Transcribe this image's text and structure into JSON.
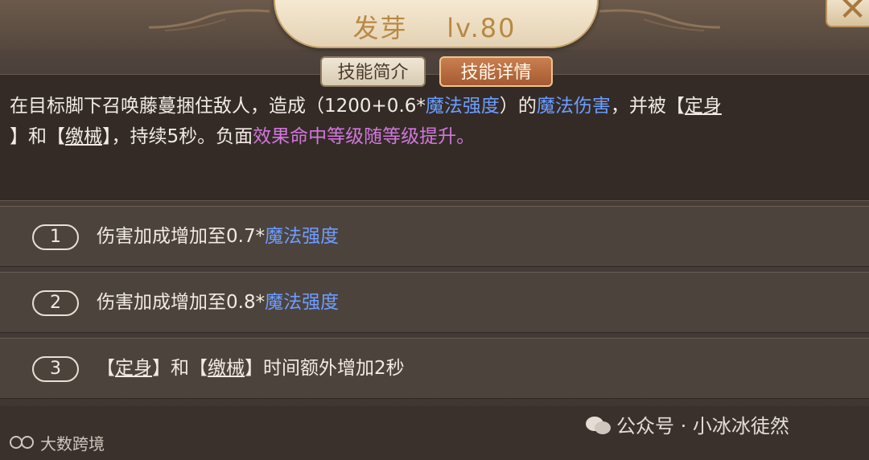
{
  "header": {
    "skill_name": "发芽",
    "level": "lv.80",
    "close_label": "✕"
  },
  "tabs": [
    {
      "label": "技能简介",
      "active": false
    },
    {
      "label": "技能详情",
      "active": true
    }
  ],
  "description": {
    "line1_pre": "在目标脚下召唤藤蔓捆住敌人，造成（1200+0.6*",
    "line1_link1": "魔法强度",
    "line1_mid": "）的",
    "line1_link2": "魔法伤害",
    "line1_post": "，并被【",
    "line1_tag": "定身",
    "line2_pre": "】和【",
    "line2_tag": "缴械",
    "line2_mid": "】，持续5秒。负面",
    "line2_effect": "效果命中等级随等级提升。"
  },
  "upgrades": [
    {
      "num": "1",
      "text": "伤害加成增加至0.7*",
      "link": "魔法强度"
    },
    {
      "num": "2",
      "text": "伤害加成增加至0.8*",
      "link": "魔法强度"
    },
    {
      "num": "3",
      "pre": "【",
      "tag1": "定身",
      "mid": "】和【",
      "tag2": "缴械",
      "post": "】时间额外增加2秒"
    }
  ],
  "watermarks": {
    "left": "大数跨境",
    "right": "公众号 · 小冰冰徒然"
  },
  "colors": {
    "link_blue": "#6d9eff",
    "effect_pink": "#d277dc",
    "title_gold": "#b88943"
  }
}
